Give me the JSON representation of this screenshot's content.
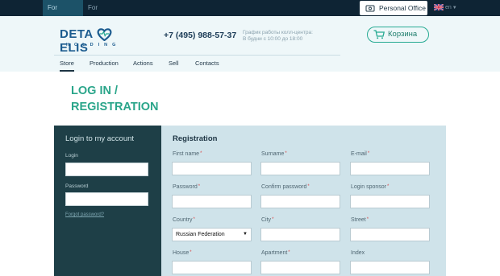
{
  "topbar": {
    "tabs": [
      {
        "label": "For Clients",
        "active": true
      },
      {
        "label": "For Partners",
        "active": false
      }
    ],
    "personal_office": "Personal Office",
    "language": "en"
  },
  "header": {
    "logo": {
      "word_left": "DETA",
      "word_right": "ELIS",
      "sub": "HOLDING"
    },
    "phone": "+7 (495) 988-57-37",
    "hours_line1": "График работы колл-центра:",
    "hours_line2": "В будни с 10:00 до 18:00",
    "cart_label": "Корзина",
    "nav": [
      {
        "label": "Store",
        "active": true
      },
      {
        "label": "Production",
        "active": false
      },
      {
        "label": "Actions",
        "active": false
      },
      {
        "label": "Sell",
        "active": false
      },
      {
        "label": "Contacts",
        "active": false
      }
    ]
  },
  "page": {
    "title_line1": "LOG IN /",
    "title_line2": "REGISTRATION"
  },
  "login": {
    "heading": "Login to my account",
    "login_label": "Login",
    "login_value": "",
    "password_label": "Password",
    "password_value": "",
    "forgot": "Forgot password?"
  },
  "registration": {
    "heading": "Registration",
    "fields": [
      {
        "label": "First name",
        "required": true,
        "value": ""
      },
      {
        "label": "Surname",
        "required": true,
        "value": ""
      },
      {
        "label": "E-mail",
        "required": true,
        "value": ""
      },
      {
        "label": "Password",
        "required": true,
        "value": ""
      },
      {
        "label": "Confirm password",
        "required": true,
        "value": ""
      },
      {
        "label": "Login sponsor",
        "required": true,
        "value": ""
      },
      {
        "label": "Country",
        "required": true,
        "value": "Russian Federation"
      },
      {
        "label": "City",
        "required": true,
        "value": ""
      },
      {
        "label": "Street",
        "required": true,
        "value": ""
      },
      {
        "label": "House",
        "required": true,
        "value": ""
      },
      {
        "label": "Apartment",
        "required": true,
        "value": ""
      },
      {
        "label": "Index",
        "required": false,
        "value": ""
      }
    ]
  },
  "colors": {
    "topbar_bg": "#0e2434",
    "header_bg": "#eef7f9",
    "accent_green": "#2aa58a",
    "login_panel": "#1e3f47",
    "reg_panel": "#cfe3ea",
    "required_mark": "#d94b4b"
  }
}
